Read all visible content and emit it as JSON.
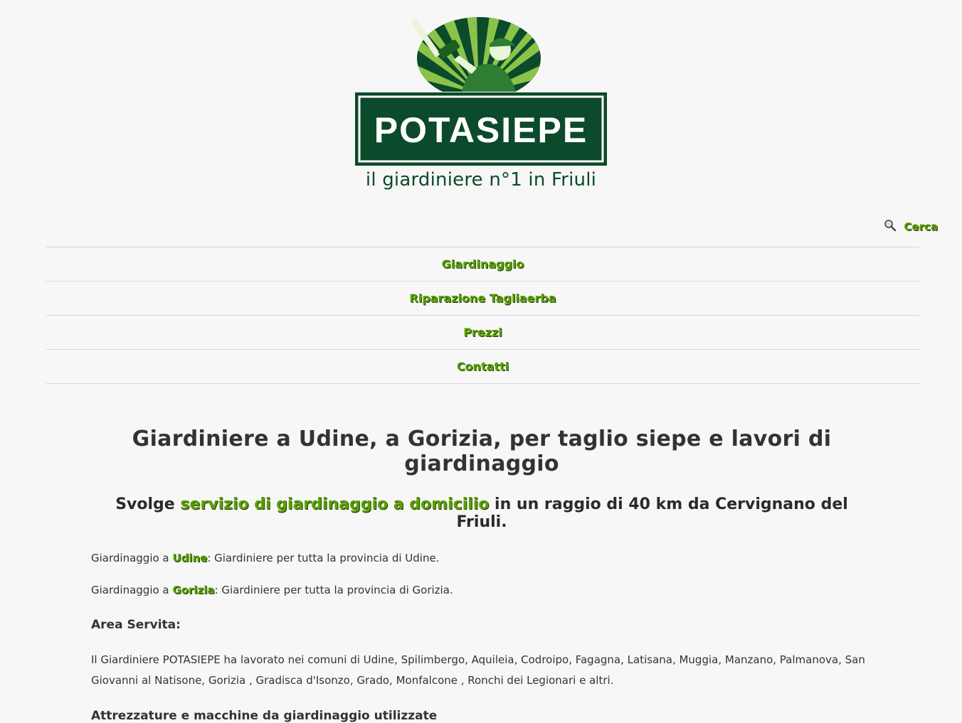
{
  "logo": {
    "brand_text": "POTASIEPE",
    "colors": {
      "dark": "#0b4a2a",
      "light": "#8bc34a"
    }
  },
  "header": {
    "tagline": "il giardiniere n°1 in Friuli"
  },
  "search": {
    "icon": "search-icon",
    "label": "Cerca"
  },
  "nav": {
    "items": [
      {
        "label": "Giardinaggio"
      },
      {
        "label": "Riparazione Tagliaerba"
      },
      {
        "label": "Prezzi"
      },
      {
        "label": "Contatti"
      }
    ]
  },
  "main": {
    "title": "Giardiniere a Udine, a Gorizia, per taglio siepe e lavori di giardinaggio",
    "subtitle": {
      "prefix": "Svolge ",
      "link": "servizio di giardinaggio a domicilio",
      "suffix": " in un raggio di 40 km da Cervignano del Friuli."
    },
    "udine": {
      "prefix": "Giardinaggio a ",
      "link": "Udine",
      "suffix": ": Giardiniere per tutta la provincia di Udine."
    },
    "gorizia": {
      "prefix": "Giardinaggio a ",
      "link": "Gorizia",
      "suffix": ": Giardiniere per tutta la provincia di Gorizia."
    },
    "area_heading": "Area Servita:",
    "area_text": "Il Giardiniere POTASIEPE ha lavorato nei comuni di Udine, Spilimbergo, Aquileia, Codroipo, Fagagna, Latisana, Muggia, Manzano, Palmanova, San Giovanni al Natisone, Gorizia , Gradisca d'Isonzo, Grado, Monfalcone , Ronchi dei Legionari e altri.",
    "equipment_heading": "Attrezzature e macchine da giardinaggio utilizzate"
  },
  "colors": {
    "accent": "#5aa000",
    "brand_dark": "#0b4a2a",
    "background": "#f7f7f7"
  }
}
